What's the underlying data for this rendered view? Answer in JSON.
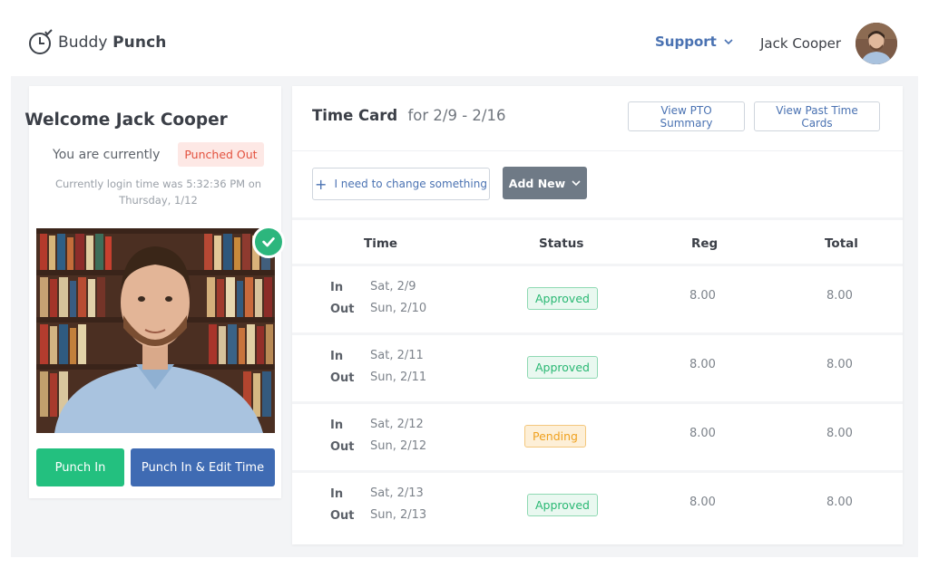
{
  "header": {
    "logo_light": "Buddy",
    "logo_bold": "Punch",
    "support_label": "Support",
    "user_name": "Jack Cooper"
  },
  "left_panel": {
    "welcome": "Welcome Jack Cooper",
    "status_prefix": "You are currently",
    "status_badge": "Punched Out",
    "login_time_line1": "Currently login time was 5:32:36 PM on",
    "login_time_line2": "Thursday, 1/12",
    "punch_in_label": "Punch In",
    "punch_in_edit_label": "Punch In & Edit Time"
  },
  "timecard": {
    "title": "Time Card",
    "range": "for 2/9 - 2/16",
    "view_pto_label": "View PTO Summary",
    "view_past_label": "View Past Time Cards",
    "change_label": "I need to change something",
    "add_new_label": "Add New",
    "columns": [
      "Time",
      "Status",
      "Reg",
      "Total"
    ],
    "in_label": "In",
    "out_label": "Out",
    "rows": [
      {
        "in": "Sat, 2/9",
        "out": "Sun, 2/10",
        "status": "Approved",
        "reg": "8.00",
        "total": "8.00"
      },
      {
        "in": "Sat, 2/11",
        "out": "Sun, 2/11",
        "status": "Approved",
        "reg": "8.00",
        "total": "8.00"
      },
      {
        "in": "Sat, 2/12",
        "out": "Sun, 2/12",
        "status": "Pending",
        "reg": "8.00",
        "total": "8.00"
      },
      {
        "in": "Sat, 2/13",
        "out": "Sun, 2/13",
        "status": "Approved",
        "reg": "8.00",
        "total": "8.00"
      }
    ]
  },
  "colors": {
    "accent_blue": "#4a72b2",
    "punch_in_green": "#23c07f",
    "punch_edit_blue": "#3f6bb3",
    "approved_green": "#29b873",
    "pending_orange": "#efa11f",
    "punched_out_red": "#e3523f"
  },
  "icons": {
    "logo": "clock-check-icon",
    "support_chevron": "chevron-down-icon",
    "add_new_chevron": "chevron-down-icon",
    "change_plus": "plus-icon",
    "photo_check": "check-circle-icon"
  }
}
